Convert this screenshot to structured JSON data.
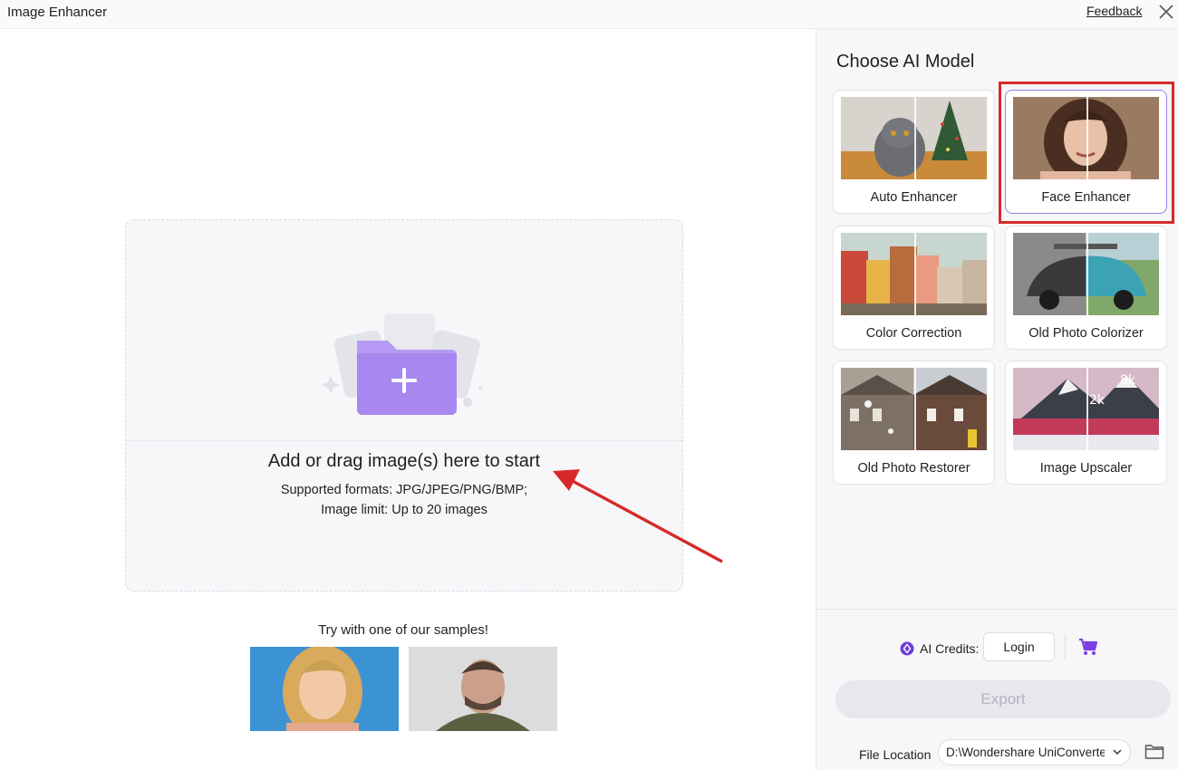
{
  "window": {
    "title": "Image Enhancer",
    "feedback_label": "Feedback"
  },
  "dropzone": {
    "title": "Add or drag image(s) here to start",
    "formats": "Supported formats: JPG/JPEG/PNG/BMP;",
    "limit": "Image limit: Up to 20 images"
  },
  "samples": {
    "title": "Try with one of our samples!"
  },
  "panel": {
    "title": "Choose AI Model",
    "models": [
      {
        "label": "Auto Enhancer",
        "selected": false
      },
      {
        "label": "Face Enhancer",
        "selected": true
      },
      {
        "label": "Color Correction",
        "selected": false
      },
      {
        "label": "Old Photo Colorizer",
        "selected": false
      },
      {
        "label": "Old Photo Restorer",
        "selected": false
      },
      {
        "label": "Image Upscaler",
        "selected": false
      }
    ],
    "upscaler_badges": {
      "low": "2k",
      "high": "8k"
    }
  },
  "footer": {
    "credits_label": "AI Credits:",
    "login_label": "Login",
    "export_label": "Export",
    "file_location_label": "File Location",
    "file_location_value": "D:\\Wondershare UniConverter"
  },
  "colors": {
    "accent": "#9b7ee8",
    "highlight": "#d62a2a",
    "cart": "#7b3fe4",
    "folder": "#b69af5"
  }
}
